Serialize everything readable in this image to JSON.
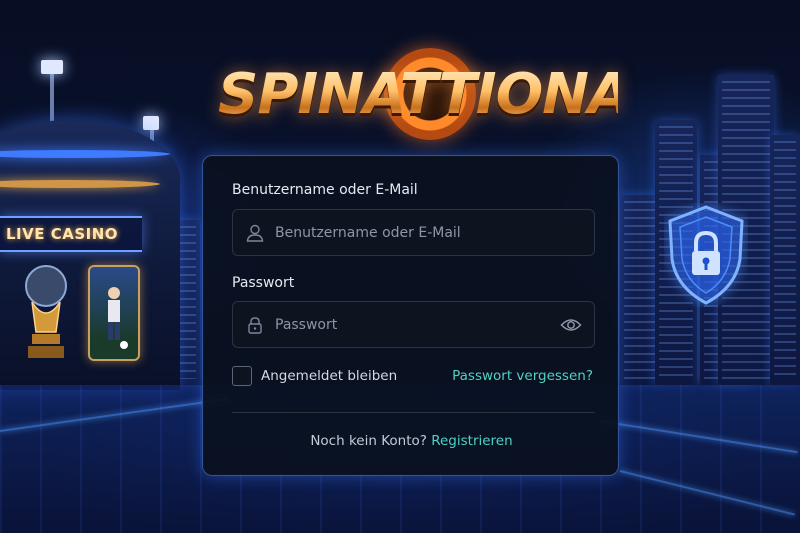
{
  "brand": {
    "logo_text": "SPINATTIONAL"
  },
  "scene": {
    "live_casino_sign": "LIVE CASINO"
  },
  "login": {
    "username_label": "Benutzername oder E-Mail",
    "username_placeholder": "Benutzername oder E-Mail",
    "username_value": "",
    "password_label": "Passwort",
    "password_placeholder": "Passwort",
    "password_value": "",
    "remember_label": "Angemeldet bleiben",
    "remember_checked": false,
    "forgot_link": "Passwort vergessen?",
    "no_account_text": "Noch kein Konto?",
    "register_link": "Registrieren"
  },
  "icons": {
    "username": "user-icon",
    "password": "lock-icon",
    "toggle_password": "eye-icon",
    "security": "shield-lock-icon"
  },
  "colors": {
    "accent": "#4fd1c5",
    "card_border": "#3f7bff",
    "logo_gold": "#ffc067",
    "logo_chip": "#ff8a2a"
  }
}
